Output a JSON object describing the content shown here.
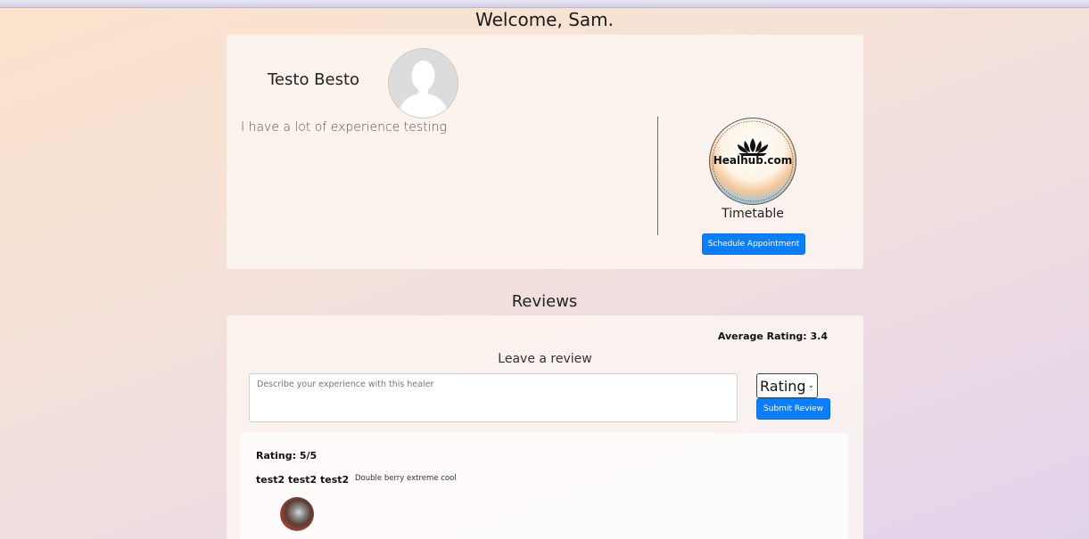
{
  "header": {
    "welcome": "Welcome, Sam."
  },
  "profile": {
    "name": "Testo Besto",
    "bio": "I have a lot of experience testing",
    "logo_text": "Healhub.com",
    "timetable_label": "Timetable",
    "schedule_button": "Schedule Appointment"
  },
  "reviews": {
    "title": "Reviews",
    "average_rating": "Average Rating: 3.4",
    "leave_review_label": "Leave a review",
    "input_placeholder": "Describe your experience with this healer",
    "rating_select": "Rating",
    "submit_button": "Submit Review",
    "items": [
      {
        "rating": "Rating: 5/5",
        "author": "test2 test2 test2",
        "text": "Double berry extreme cool"
      }
    ]
  },
  "colors": {
    "primary_button": "#0d7efb"
  }
}
